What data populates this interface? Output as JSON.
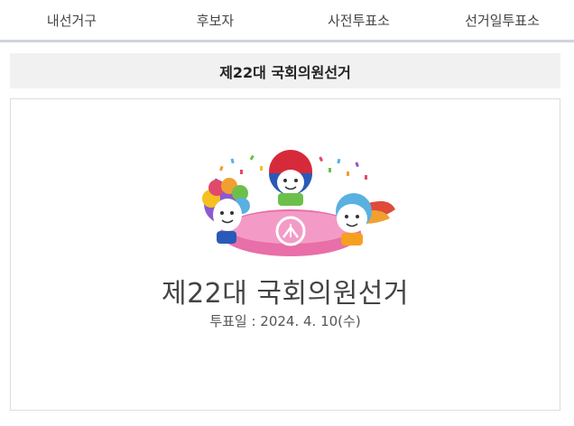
{
  "tabs": [
    {
      "label": "내선거구"
    },
    {
      "label": "후보자"
    },
    {
      "label": "사전투표소"
    },
    {
      "label": "선거일투표소"
    }
  ],
  "section": {
    "title": "제22대 국회의원선거"
  },
  "card": {
    "election_name": "제22대 국회의원선거",
    "vote_date": "투표일 : 2024. 4. 10(수)",
    "illustration": "election-mascots-icon"
  },
  "colors": {
    "tab_border": "#cfd3dc",
    "title_bg": "#f1f1f1",
    "card_border": "#dddddd",
    "ballot_pink": "#e86fa8"
  }
}
